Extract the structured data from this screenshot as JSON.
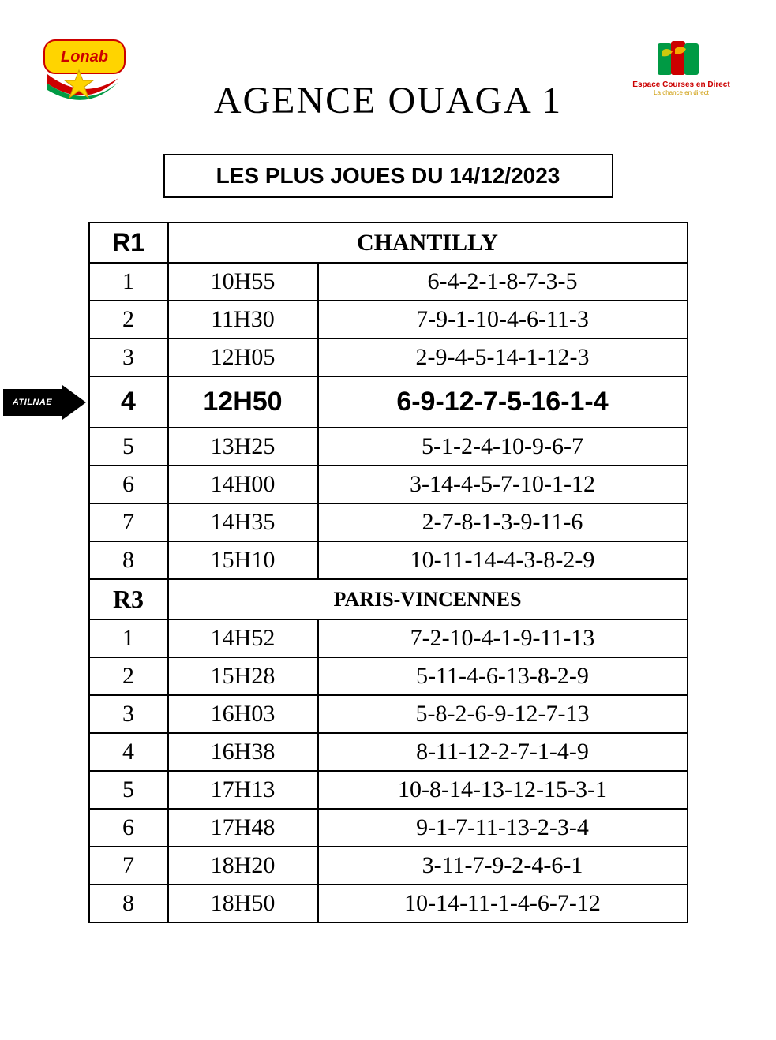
{
  "logos": {
    "left_text": "Lonab",
    "right_line1": "Espace Courses en Direct",
    "right_line2": "La chance en direct"
  },
  "page_title": "AGENCE  OUAGA 1",
  "subtitle": "LES PLUS JOUES DU 14/12/2023",
  "arrow_label": "ATILNAE",
  "sections": [
    {
      "code": "R1",
      "name": "CHANTILLY",
      "rows": [
        {
          "num": "1",
          "time": "10H55",
          "picks": "6-4-2-1-8-7-3-5",
          "highlight": false
        },
        {
          "num": "2",
          "time": "11H30",
          "picks": "7-9-1-10-4-6-11-3",
          "highlight": false
        },
        {
          "num": "3",
          "time": "12H05",
          "picks": "2-9-4-5-14-1-12-3",
          "highlight": false
        },
        {
          "num": "4",
          "time": "12H50",
          "picks": "6-9-12-7-5-16-1-4",
          "highlight": true
        },
        {
          "num": "5",
          "time": "13H25",
          "picks": "5-1-2-4-10-9-6-7",
          "highlight": false
        },
        {
          "num": "6",
          "time": "14H00",
          "picks": "3-14-4-5-7-10-1-12",
          "highlight": false
        },
        {
          "num": "7",
          "time": "14H35",
          "picks": "2-7-8-1-3-9-11-6",
          "highlight": false
        },
        {
          "num": "8",
          "time": "15H10",
          "picks": "10-11-14-4-3-8-2-9",
          "highlight": false
        }
      ]
    },
    {
      "code": "R3",
      "name": "PARIS-VINCENNES",
      "rows": [
        {
          "num": "1",
          "time": "14H52",
          "picks": "7-2-10-4-1-9-11-13",
          "highlight": false
        },
        {
          "num": "2",
          "time": "15H28",
          "picks": "5-11-4-6-13-8-2-9",
          "highlight": false
        },
        {
          "num": "3",
          "time": "16H03",
          "picks": "5-8-2-6-9-12-7-13",
          "highlight": false
        },
        {
          "num": "4",
          "time": "16H38",
          "picks": "8-11-12-2-7-1-4-9",
          "highlight": false
        },
        {
          "num": "5",
          "time": "17H13",
          "picks": "10-8-14-13-12-15-3-1",
          "highlight": false
        },
        {
          "num": "6",
          "time": "17H48",
          "picks": "9-1-7-11-13-2-3-4",
          "highlight": false
        },
        {
          "num": "7",
          "time": "18H20",
          "picks": "3-11-7-9-2-4-6-1",
          "highlight": false
        },
        {
          "num": "8",
          "time": "18H50",
          "picks": "10-14-11-1-4-6-7-12",
          "highlight": false
        }
      ]
    }
  ]
}
